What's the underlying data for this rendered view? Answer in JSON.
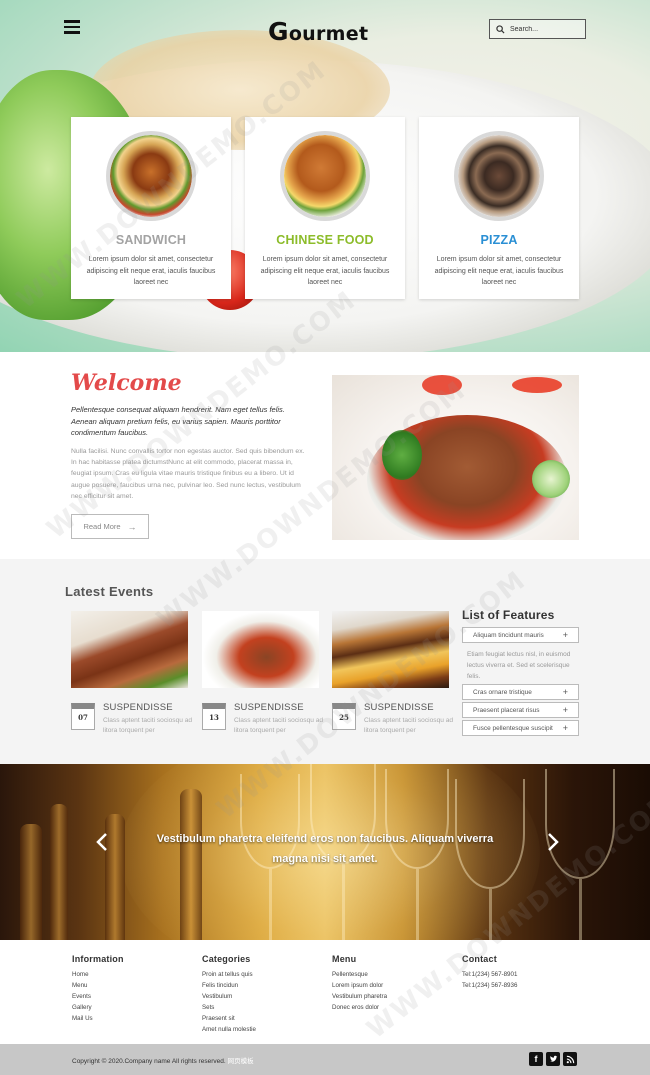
{
  "header": {
    "logo_initial": "G",
    "logo_rest": "ourmet",
    "search_placeholder": "Search..."
  },
  "cards": [
    {
      "title": "SANDWICH",
      "color": "#a3a3a3",
      "text": "Lorem ipsum dolor sit amet, consectetur adipiscing elit neque erat, iaculis faucibus laoreet nec"
    },
    {
      "title": "CHINESE FOOD",
      "color": "#8cbc2a",
      "text": "Lorem ipsum dolor sit amet, consectetur adipiscing elit neque erat, iaculis faucibus laoreet nec"
    },
    {
      "title": "PIZZA",
      "color": "#2a8fd4",
      "text": "Lorem ipsum dolor sit amet, consectetur adipiscing elit neque erat, iaculis faucibus laoreet nec"
    }
  ],
  "welcome": {
    "title": "Welcome",
    "lead": "Pellentesque consequat aliquam hendrerit. Nam eget tellus felis. Aenean aliquam pretium felis, eu varius sapien. Mauris porttitor condimentum faucibus.",
    "body": "Nulla facilisi. Nunc convallis tortor non egestas auctor. Sed quis bibendum ex. In hac habitasse platea dictumstNunc at elit commodo, placerat massa in, feugiat ipsum. Cras eu ligula vitae mauris tristique finibus eu a libero. Ut id augue posuere, faucibus urna nec, pulvinar leo. Sed nunc lectus, vestibulum nec efficitur sit amet.",
    "read_more": "Read More"
  },
  "events": {
    "title": "Latest Events",
    "items": [
      {
        "date": "07",
        "title": "SUSPENDISSE",
        "text": "Class aptent taciti sociosqu ad litora torquent per"
      },
      {
        "date": "13",
        "title": "SUSPENDISSE",
        "text": "Class aptent taciti sociosqu ad litora torquent per"
      },
      {
        "date": "25",
        "title": "SUSPENDISSE",
        "text": "Class aptent taciti sociosqu ad litora torquent per"
      }
    ]
  },
  "features": {
    "title": "List of Features",
    "open_item": "Aliquam tincidunt mauris",
    "open_body": "Etiam feugiat lectus nisl, in euismod lectus viverra et. Sed et scelerisque felis.",
    "items": [
      "Cras ornare tristique",
      "Praesent placerat risus",
      "Fusce pellentesque suscipit"
    ],
    "plus": "+"
  },
  "slider": {
    "caption": "Vestibulum pharetra eleifend eros non faucibus. Aliquam viverra magna nisi sit amet."
  },
  "footer": {
    "columns": [
      {
        "title": "Information",
        "links": [
          "Home",
          "Menu",
          "Events",
          "Gallery",
          "Mail Us"
        ]
      },
      {
        "title": "Categories",
        "links": [
          "Proin at tellus quis",
          "Felis tincidun",
          "Vestibulum",
          "Sets",
          "Praesent sit",
          "Amet nulla molestie"
        ]
      },
      {
        "title": "Menu",
        "links": [
          "Pellentesque",
          "Lorem ipsum dolor",
          "Vestibulum pharetra",
          "Donec eros dolor"
        ]
      },
      {
        "title": "Contact",
        "links": [
          "Tel:1(234) 567-8901",
          "Tel:1(234) 567-8936"
        ]
      }
    ],
    "copyright": "Copyright © 2020.Company name All rights reserved.",
    "copyright_tag": "网页模板",
    "social": [
      "f",
      "t",
      "rss"
    ]
  },
  "watermark": "WWW.DOWNDEMO.COM"
}
